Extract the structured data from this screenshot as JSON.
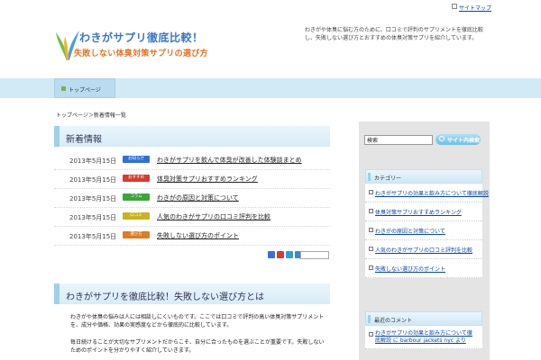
{
  "header": {
    "sitemap_label": "サイトマップ",
    "logo": {
      "line1": "わきがサプリ徹底比較！",
      "line2": "失敗しない体臭対策サプリの選び方"
    },
    "description": "わきがや体臭に悩む方のために、口コミで評判のサプリメントを徹底比較し、失敗しない選び方とおすすめの体臭対策サプリを紹介しています。"
  },
  "nav": {
    "items": [
      {
        "label": "トップページ"
      }
    ]
  },
  "breadcrumb": "トップページ＞新着情報一覧",
  "news": {
    "title": "新着情報",
    "items": [
      {
        "date": "2013年5月15日",
        "badge": "お知らせ",
        "badge_color": "#2f6fd8",
        "title": "わきがサプリを飲んで体臭が改善した体験談まとめ"
      },
      {
        "date": "2013年5月15日",
        "badge": "おすすめ",
        "badge_color": "#d83a2f",
        "title": "体臭対策サプリおすすめランキング"
      },
      {
        "date": "2013年5月15日",
        "badge": "コラム",
        "badge_color": "#3aa63a",
        "title": "わきがの原因と対策について"
      },
      {
        "date": "2013年5月15日",
        "badge": "口コミ",
        "badge_color": "#c9b21f",
        "title": "人気のわきがサプリの口コミ評判を比較"
      },
      {
        "date": "2013年5月15日",
        "badge": "選び方",
        "badge_color": "#e07b1f",
        "title": "失敗しない選び方のポイント"
      }
    ],
    "share_colors": [
      "#3a6fd8",
      "#d83a2f",
      "#2f9fd8",
      "#3a88d8"
    ]
  },
  "article": {
    "title": "わきがサプリを徹底比較！失敗しない選び方とは",
    "para1": "わきがや体臭の悩みは人には相談しにくいものです。ここでは口コミで評判の高い体臭対策サプリメントを、成分や価格、効果の実感度などから徹底的に比較しています。",
    "para2": "毎日続けることが大切なサプリメントだからこそ、自分に合ったものを選ぶことが重要です。失敗しないためのポイントを分かりやすく紹介していきます。"
  },
  "sidebar": {
    "search_value": "検索",
    "search_button": "サイト内検索",
    "widget1": {
      "title": "カテゴリー",
      "items": [
        "わきがサプリの効果と飲み方について徹底解説",
        "体臭対策サプリおすすめランキング",
        "わきがの原因と対策について",
        "人気のわきがサプリの口コミ評判を比較",
        "失敗しない選び方のポイント"
      ]
    },
    "widget2": {
      "title": "最近のコメント",
      "items": [
        "わきがサプリの効果と飲み方について徹底解説 に barbour jackets nyc より"
      ]
    }
  }
}
